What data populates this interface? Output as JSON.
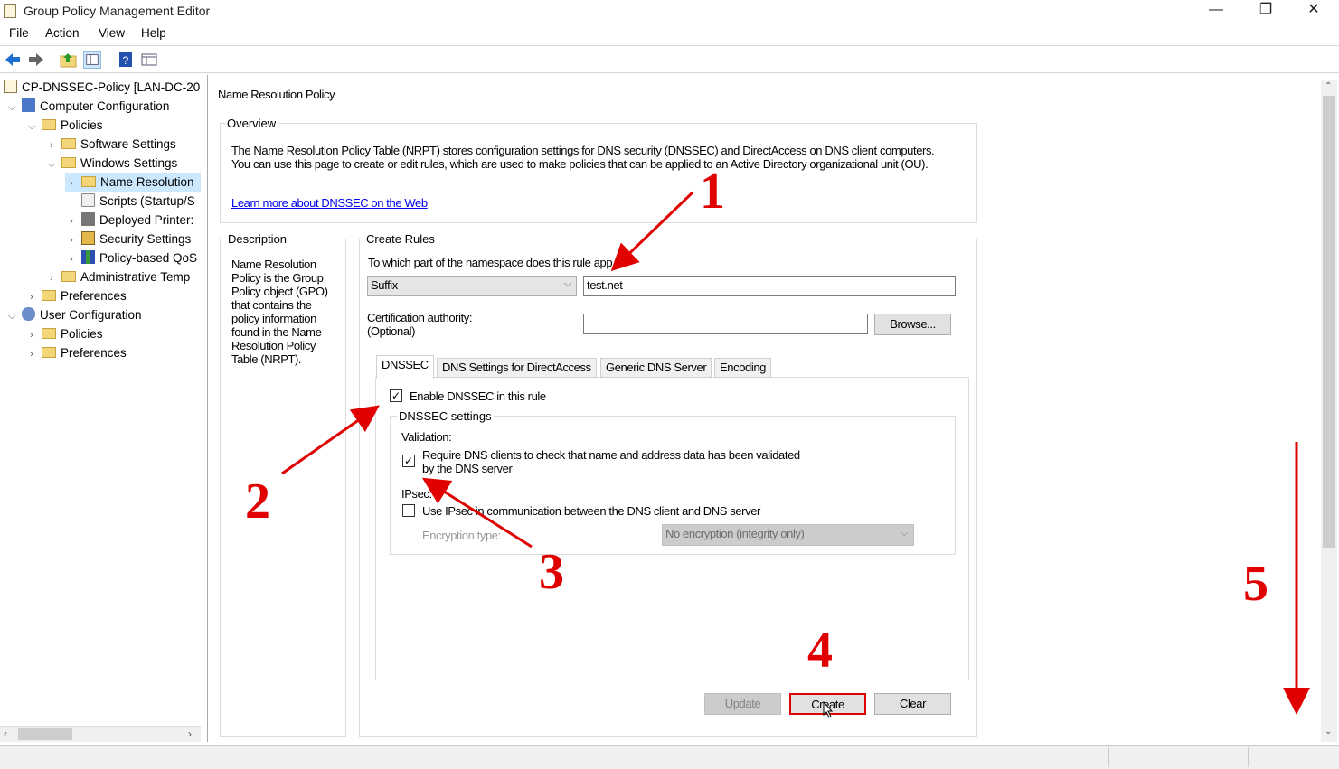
{
  "window": {
    "title": "Group Policy Management Editor",
    "minimize": "—",
    "restore": "❐",
    "close": "✕"
  },
  "menu": [
    "File",
    "Action",
    "View",
    "Help"
  ],
  "tree": {
    "root": "CP-DNSSEC-Policy [LAN-DC-20",
    "computer_config": "Computer Configuration",
    "policies": "Policies",
    "software_settings": "Software Settings",
    "windows_settings": "Windows Settings",
    "name_resolution": "Name Resolution",
    "scripts": "Scripts (Startup/S",
    "deployed_printers": "Deployed Printer:",
    "security_settings": "Security Settings",
    "policy_qos": "Policy-based QoS",
    "admin_templates": "Administrative Temp",
    "preferences": "Preferences",
    "user_config": "User Configuration",
    "user_policies": "Policies",
    "user_preferences": "Preferences"
  },
  "page": {
    "heading": "Name Resolution Policy",
    "overview_label": "Overview",
    "overview_line1": "The Name Resolution Policy Table (NRPT) stores configuration settings for DNS security (DNSSEC) and DirectAccess on DNS client computers.",
    "overview_line2": "You can use this page to create or edit rules, which are used to make policies that can be applied to an Active Directory organizational unit (OU).",
    "learn_more": "Learn more about DNSSEC on the Web",
    "description_label": "Description",
    "description_text": [
      "Name Resolution",
      "Policy is the Group",
      "Policy object (GPO)",
      "that contains the",
      "policy information",
      "found in the Name",
      "Resolution Policy",
      "Table (NRPT)."
    ],
    "create_rules_label": "Create Rules",
    "namespace_question": "To which part of the namespace does this rule app",
    "namespace_type": "Suffix",
    "namespace_value": "test.net",
    "cert_label_1": "Certification authority:",
    "cert_label_2": "(Optional)",
    "cert_value": "",
    "browse_button": "Browse...",
    "tabs": [
      "DNSSEC",
      "DNS Settings for DirectAccess",
      "Generic DNS Server",
      "Encoding"
    ],
    "enable_dnssec": "Enable DNSSEC in this rule",
    "dnssec_settings_label": "DNSSEC settings",
    "validation_label": "Validation:",
    "require_line1": "Require DNS clients to check that name and address data has been validated",
    "require_line2": "by the DNS server",
    "ipsec_label": "IPsec:",
    "use_ipsec": "Use IPsec in communication between the DNS client and DNS server",
    "encryption_label": "Encryption type:",
    "encryption_value": "No encryption (integrity only)",
    "update_button": "Update",
    "create_button": "Create",
    "clear_button": "Clear"
  },
  "annotations": {
    "n1": "1",
    "n2": "2",
    "n3": "3",
    "n4": "4",
    "n5": "5"
  },
  "colors": {
    "annotation": "#e00000",
    "link": "#0000ee"
  }
}
